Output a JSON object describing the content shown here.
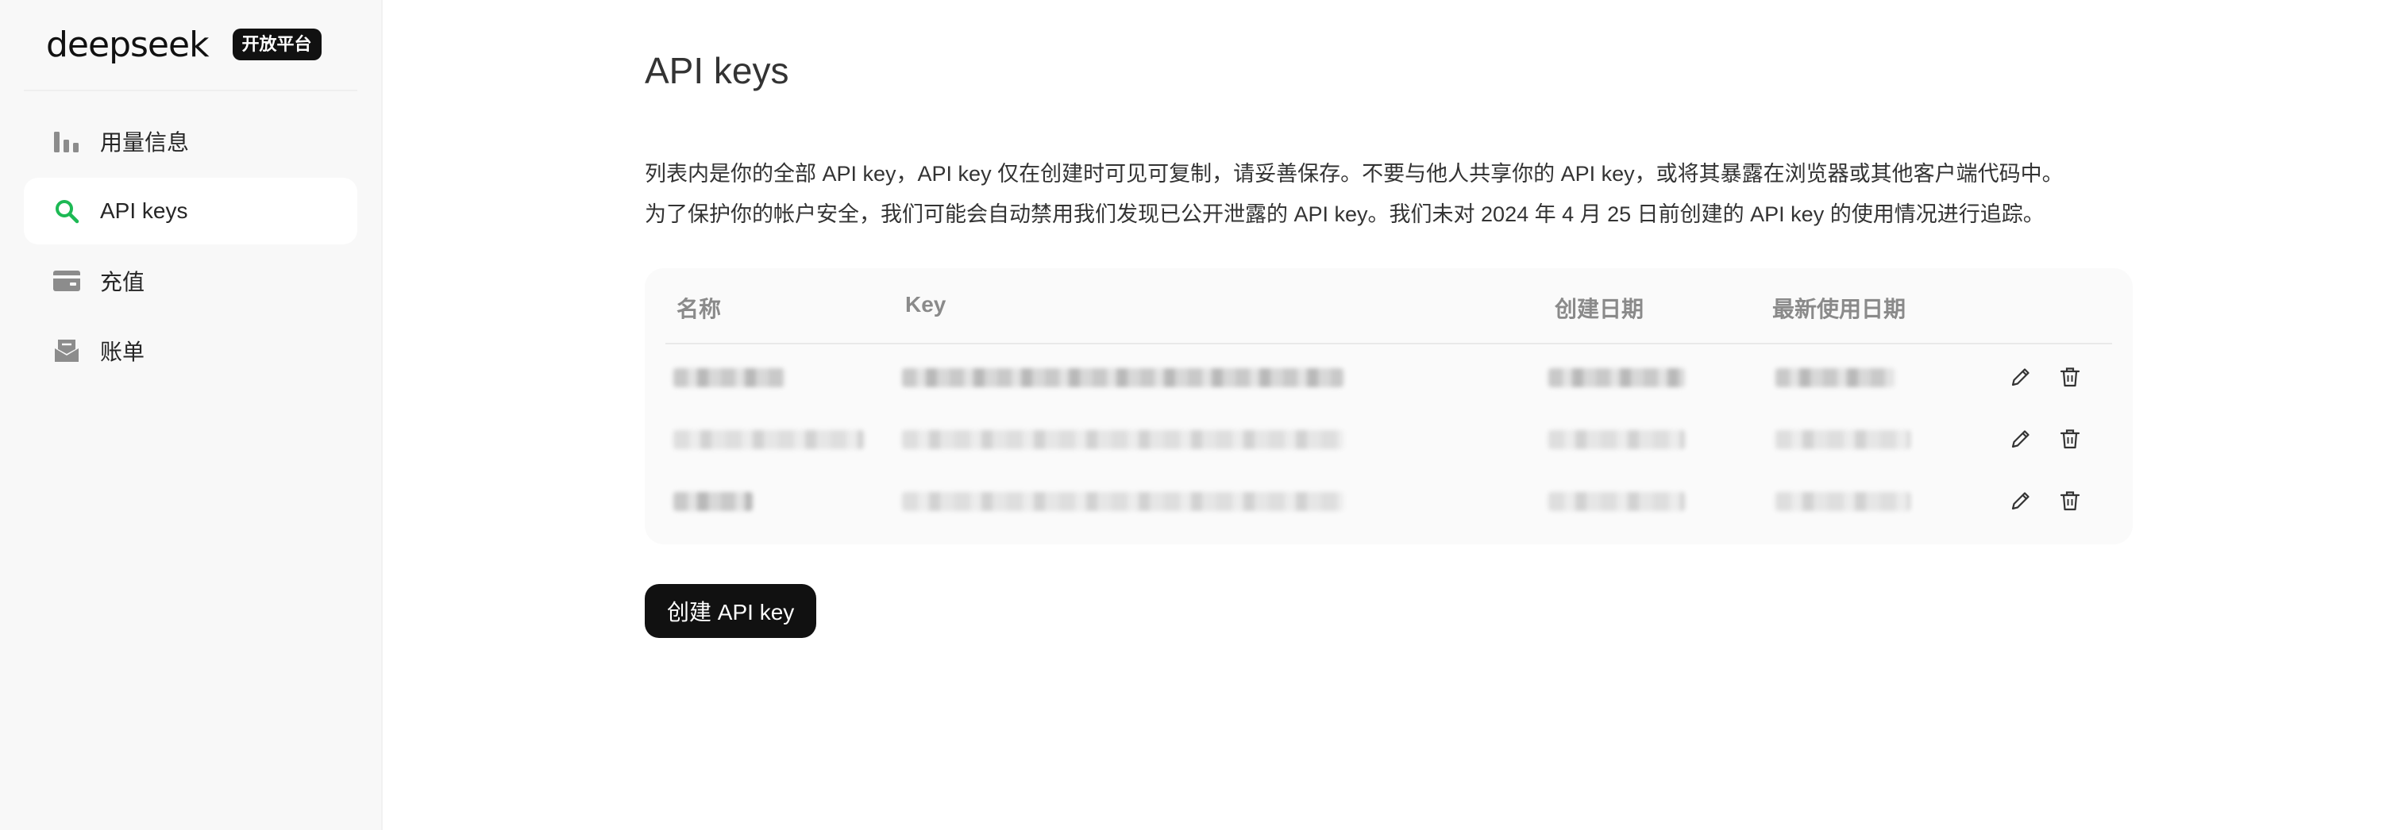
{
  "sidebar": {
    "brand_name": "deepseek",
    "brand_badge": "开放平台",
    "items": [
      {
        "label": "用量信息",
        "icon": "bar-chart-icon",
        "active": false
      },
      {
        "label": "API keys",
        "icon": "search-key-icon",
        "active": true
      },
      {
        "label": "充值",
        "icon": "wallet-icon",
        "active": false
      },
      {
        "label": "账单",
        "icon": "inbox-icon",
        "active": false
      }
    ]
  },
  "main": {
    "title": "API keys",
    "description_lines": [
      "列表内是你的全部 API key，API key 仅在创建时可见可复制，请妥善保存。不要与他人共享你的 API key，或将其暴露在浏览器或其他客户端代码中。",
      "为了保护你的帐户安全，我们可能会自动禁用我们发现已公开泄露的 API key。我们未对 2024 年 4 月 25 日前创建的 API key 的使用情况进行追踪。"
    ],
    "table": {
      "columns": [
        "名称",
        "Key",
        "创建日期",
        "最新使用日期"
      ],
      "row_count": 3
    },
    "create_button_label": "创建 API key"
  },
  "colors": {
    "accent_green": "#1db954",
    "button_bg": "#111111",
    "sidebar_bg": "#f8f8f8"
  }
}
